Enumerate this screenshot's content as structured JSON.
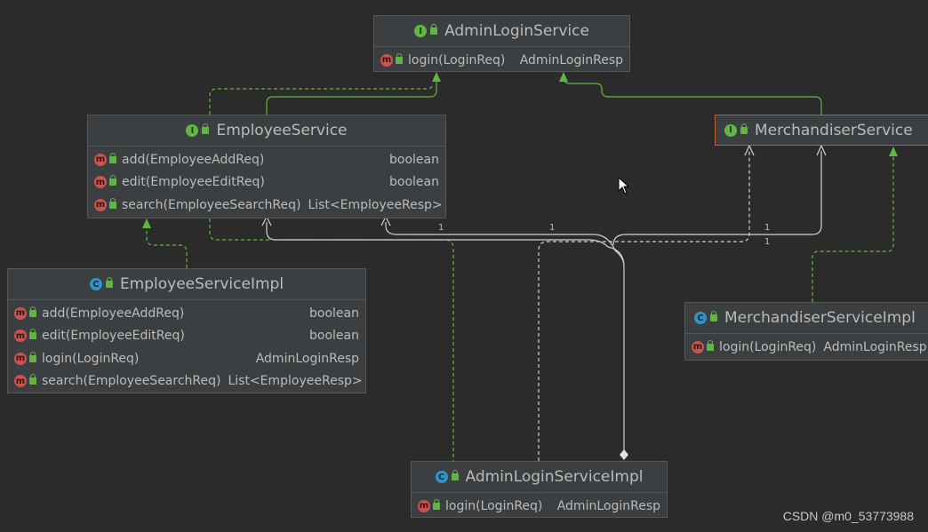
{
  "classes": {
    "admin_login_service": {
      "kind": "I",
      "name": "AdminLoginService",
      "methods": [
        {
          "sig": "login(LoginReq)",
          "ret": "AdminLoginResp"
        }
      ]
    },
    "employee_service": {
      "kind": "I",
      "name": "EmployeeService",
      "methods": [
        {
          "sig": "add(EmployeeAddReq)",
          "ret": "boolean"
        },
        {
          "sig": "edit(EmployeeEditReq)",
          "ret": "boolean"
        },
        {
          "sig": "search(EmployeeSearchReq)",
          "ret": "List<EmployeeResp>"
        }
      ]
    },
    "merchandiser_service": {
      "kind": "I",
      "name": "MerchandiserService",
      "methods": []
    },
    "employee_service_impl": {
      "kind": "C",
      "name": "EmployeeServiceImpl",
      "methods": [
        {
          "sig": "add(EmployeeAddReq)",
          "ret": "boolean"
        },
        {
          "sig": "edit(EmployeeEditReq)",
          "ret": "boolean"
        },
        {
          "sig": "login(LoginReq)",
          "ret": "AdminLoginResp"
        },
        {
          "sig": "search(EmployeeSearchReq)",
          "ret": "List<EmployeeResp>"
        }
      ]
    },
    "merchandiser_service_impl": {
      "kind": "C",
      "name": "MerchandiserServiceImpl",
      "methods": [
        {
          "sig": "login(LoginReq)",
          "ret": "AdminLoginResp"
        }
      ]
    },
    "admin_login_service_impl": {
      "kind": "C",
      "name": "AdminLoginServiceImpl",
      "methods": [
        {
          "sig": "login(LoginReq)",
          "ret": "AdminLoginResp"
        }
      ]
    }
  },
  "method_badge": "m",
  "multiplicities": [
    "1",
    "1",
    "1",
    "1"
  ],
  "watermark": "CSDN @m0_53773988",
  "colors": {
    "background": "#2b2b2b",
    "node_fill": "#3c3f41",
    "interface_badge": "#62b543",
    "class_badge": "#3592c4",
    "method_badge": "#c75454",
    "generalization_edge": "#62b543",
    "association_edge": "#cfcfcf",
    "selected_border": "#c75a2e"
  },
  "icons": {
    "interface": "interface-icon",
    "class": "class-icon",
    "method": "method-icon",
    "visibility": "public-lock-icon"
  }
}
